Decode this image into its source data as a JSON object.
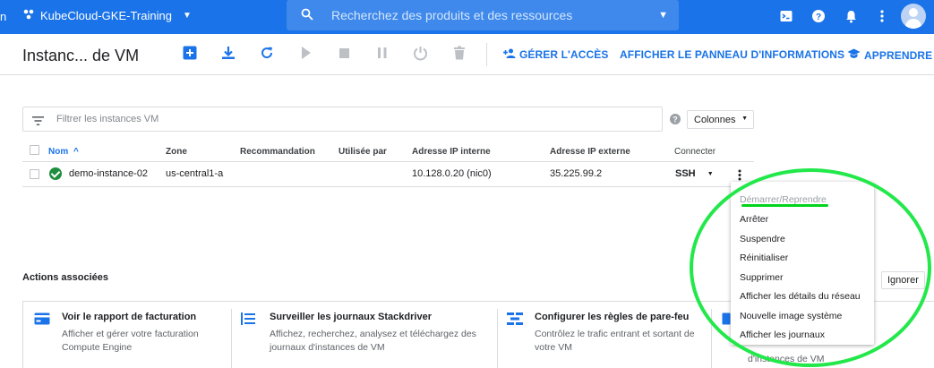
{
  "topbar": {
    "edge_letter": "n",
    "project_name": "KubeCloud-GKE-Training",
    "search_placeholder": "Recherchez des produits et des ressources"
  },
  "toolbar": {
    "title": "Instanc... de VM",
    "manage_access": "GÉRER L'ACCÈS",
    "info_panel": "AFFICHER LE PANNEAU D'INFORMATIONS",
    "learn": "APPRENDRE"
  },
  "filter": {
    "placeholder": "Filtrer les instances VM",
    "columns_button": "Colonnes"
  },
  "table": {
    "headers": {
      "name": "Nom",
      "zone": "Zone",
      "recommendation": "Recommandation",
      "used_by": "Utilisée par",
      "internal_ip": "Adresse IP interne",
      "external_ip": "Adresse IP externe",
      "connect": "Connecter"
    },
    "rows": [
      {
        "name": "demo-instance-02",
        "zone": "us-central1-a",
        "recommendation": "",
        "used_by": "",
        "internal_ip": "10.128.0.20 (nic0)",
        "external_ip": "35.225.99.2",
        "connect": "SSH"
      }
    ]
  },
  "menu": {
    "items": [
      "Démarrer/Reprendre",
      "Arrêter",
      "Suspendre",
      "Réinitialiser",
      "Supprimer",
      "Afficher les détails du réseau",
      "Nouvelle image système",
      "Afficher les journaux"
    ]
  },
  "related": {
    "title": "Actions associées",
    "ignore_button": "Ignorer",
    "cards": [
      {
        "title": "Voir le rapport de facturation",
        "desc1": "Afficher et gérer votre facturation",
        "desc2": "Compute Engine"
      },
      {
        "title": "Surveiller les journaux Stackdriver",
        "desc1": "Affichez, recherchez, analysez et téléchargez des",
        "desc2": "journaux d'instances de VM"
      },
      {
        "title": "Configurer les règles de pare-feu",
        "desc1": "Contrôlez le trafic entrant et sortant de",
        "desc2": "votre VM"
      }
    ],
    "peek_text": "d'instances de VM"
  },
  "colors": {
    "brand_blue": "#1a73e8",
    "status_green": "#1e8e3e",
    "annotation_green": "#22e84a"
  }
}
